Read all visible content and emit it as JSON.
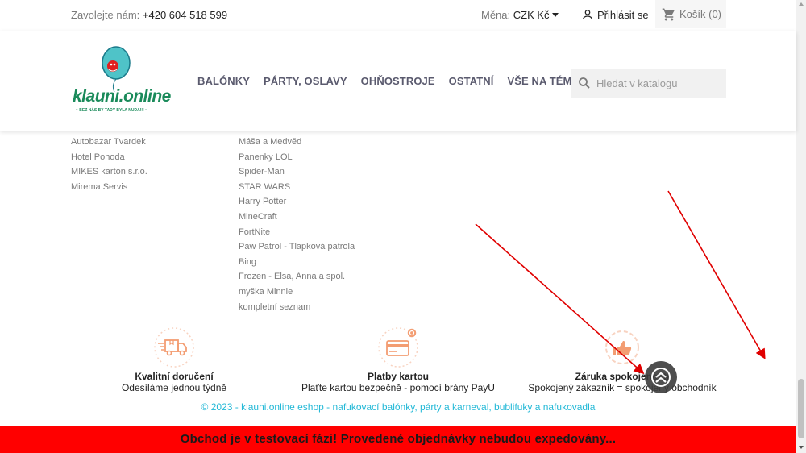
{
  "topbar": {
    "contact_label": "Zavolejte nám:",
    "phone": "+420 604 518 599",
    "currency_label": "Měna:",
    "currency_value": "CZK Kč",
    "login": "Přihlásit se",
    "cart": "Košík (0)"
  },
  "logo": {
    "text": "klauni.online",
    "tagline": "~ BEZ NÁS BY TADY BYLA NUDA!!! ~"
  },
  "nav": [
    "BALÓNKY",
    "PÁRTY, OSLAVY",
    "OHŇOSTROJE",
    "OSTATNÍ",
    "VŠE NA TÉMA"
  ],
  "search": {
    "placeholder": "Hledat v katalogu"
  },
  "footer": {
    "col1": [
      "Autobazar Tvardek",
      "Hotel Pohoda",
      "MIKES karton s.r.o.",
      "Mirema Servis"
    ],
    "col2": [
      "Máša a Medvěd",
      "Panenky LOL",
      "Spider-Man",
      "STAR WARS",
      "Harry Potter",
      "MineCraft",
      "FortNite",
      "Paw Patrol - Tlapková patrola",
      "Bing",
      "Frozen - Elsa, Anna a spol.",
      "myška Minnie",
      "kompletní seznam"
    ]
  },
  "reassurance": [
    {
      "title": "Kvalitní doručení",
      "desc": "Odesíláme jednou týdně",
      "icon": "delivery-truck-icon"
    },
    {
      "title": "Platby kartou",
      "desc": "Plaťte kartou bezpečně - pomocí brány PayU",
      "icon": "credit-card-icon"
    },
    {
      "title": "Záruka spokojenosti",
      "desc": "Spokojený zákazník = spokojený obchodník",
      "icon": "thumbs-up-icon"
    }
  ],
  "copyright": "© 2023 - klauni.online eshop - nafukovací balónky, párty a karneval, bublifuky a nafukovadla",
  "banner": "Obchod je v testovací fázi! Provedené objednávky nebudou expedovány...",
  "colors": {
    "accent": "#f39d72",
    "link": "#24b9d7",
    "banner": "#ff0000",
    "annotation": "#e00000"
  }
}
